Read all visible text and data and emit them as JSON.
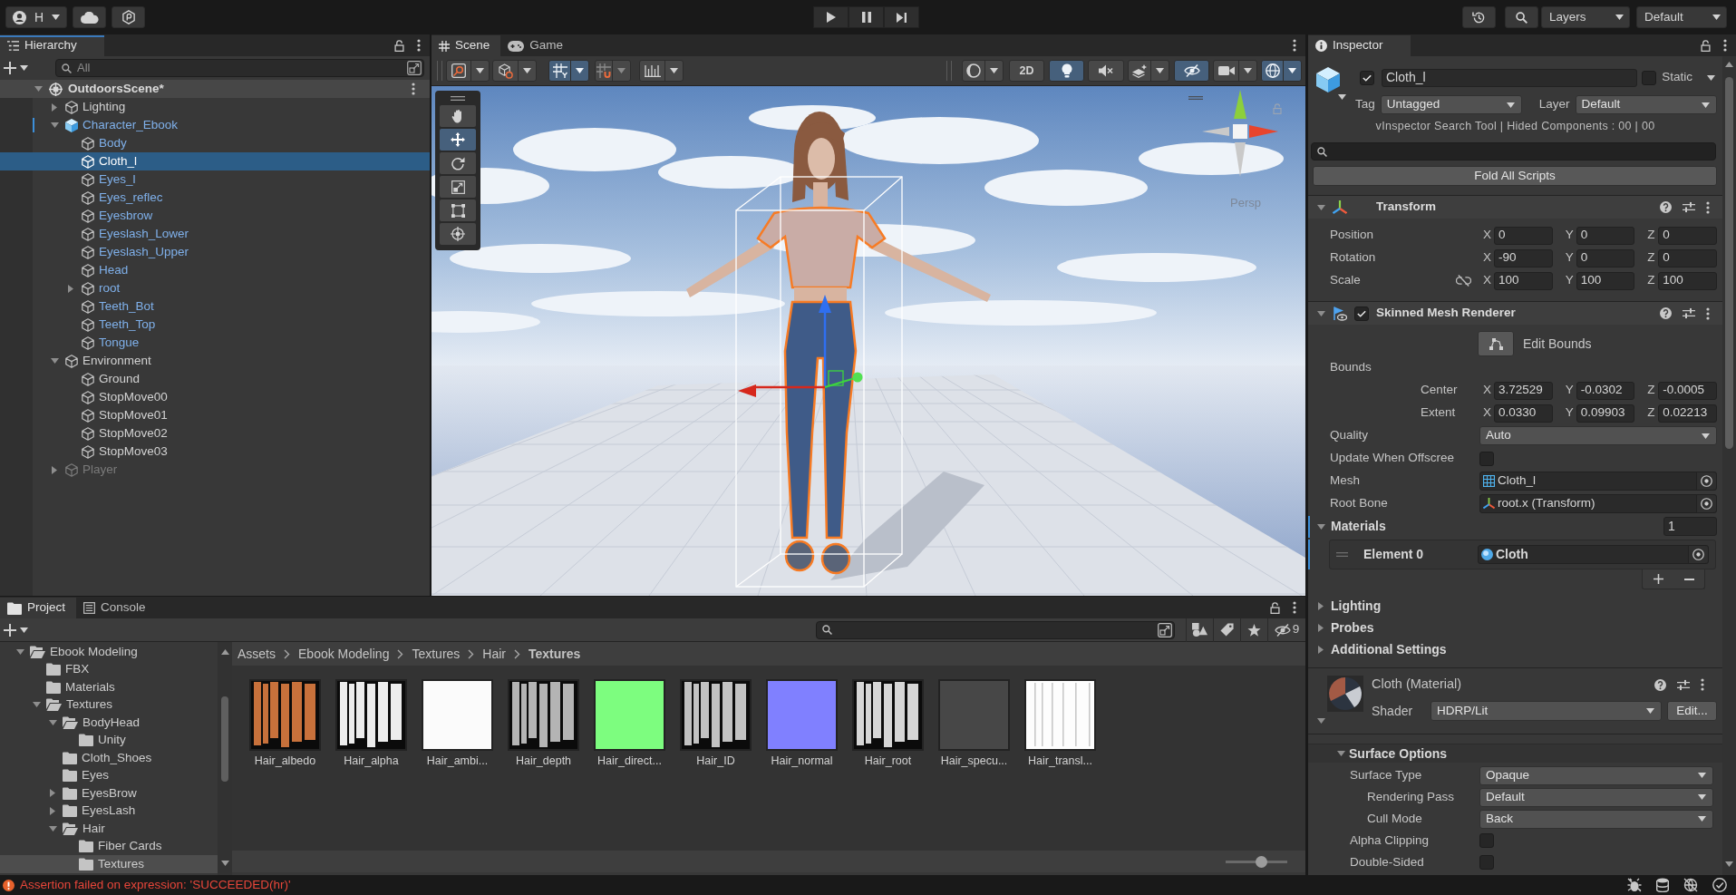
{
  "top_bar": {
    "account": "H",
    "layers": "Layers",
    "layout": "Default"
  },
  "hierarchy": {
    "tab": {
      "label": "Hierarchy",
      "selected": true,
      "focused": true
    },
    "search": {
      "placeholder": "All"
    },
    "scene": {
      "name": "OutdoorsScene*",
      "expanded": true
    },
    "items": [
      {
        "name": "Lighting",
        "kind": "object",
        "expanded": false,
        "overridden": false,
        "disabled": false,
        "selected": false
      },
      {
        "name": "Character_Ebook",
        "kind": "prefab_root",
        "expanded": true,
        "overridden": true,
        "disabled": false,
        "selected": false,
        "children": [
          {
            "name": "Body",
            "kind": "prefab_part",
            "disabled": false,
            "selected": false
          },
          {
            "name": "Cloth_l",
            "kind": "prefab_part",
            "disabled": false,
            "selected": true
          },
          {
            "name": "Eyes_l",
            "kind": "prefab_part",
            "disabled": false,
            "selected": false
          },
          {
            "name": "Eyes_reflec",
            "kind": "prefab_part",
            "disabled": false,
            "selected": false
          },
          {
            "name": "Eyesbrow",
            "kind": "prefab_part",
            "disabled": false,
            "selected": false
          },
          {
            "name": "Eyeslash_Lower",
            "kind": "prefab_part",
            "disabled": false,
            "selected": false
          },
          {
            "name": "Eyeslash_Upper",
            "kind": "prefab_part",
            "disabled": false,
            "selected": false
          },
          {
            "name": "Head",
            "kind": "prefab_part",
            "disabled": false,
            "selected": false
          },
          {
            "name": "root",
            "kind": "prefab_part",
            "expanded": false,
            "disabled": false,
            "selected": false
          },
          {
            "name": "Teeth_Bot",
            "kind": "prefab_part",
            "disabled": false,
            "selected": false
          },
          {
            "name": "Teeth_Top",
            "kind": "prefab_part",
            "disabled": false,
            "selected": false
          },
          {
            "name": "Tongue",
            "kind": "prefab_part",
            "disabled": false,
            "selected": false
          }
        ]
      },
      {
        "name": "Environment",
        "kind": "object",
        "expanded": true,
        "overridden": false,
        "disabled": false,
        "selected": false,
        "children": [
          {
            "name": "Ground",
            "kind": "object",
            "disabled": false,
            "selected": false
          },
          {
            "name": "StopMove00",
            "kind": "object",
            "disabled": false,
            "selected": false
          },
          {
            "name": "StopMove01",
            "kind": "object",
            "disabled": false,
            "selected": false
          },
          {
            "name": "StopMove02",
            "kind": "object",
            "disabled": false,
            "selected": false
          },
          {
            "name": "StopMove03",
            "kind": "object",
            "disabled": false,
            "selected": false
          }
        ]
      },
      {
        "name": "Player",
        "kind": "object",
        "expanded": false,
        "overridden": false,
        "disabled": true,
        "selected": false
      }
    ]
  },
  "scene_view": {
    "tabs": [
      {
        "label": "Scene",
        "kind": "scene",
        "selected": true
      },
      {
        "label": "Game",
        "kind": "game",
        "selected": false
      }
    ],
    "toolbar_left": [
      {
        "kind": "handle",
        "on": false
      },
      {
        "kind": "pivot",
        "on": false
      },
      {
        "kind": "grid",
        "on": true
      },
      {
        "kind": "snap",
        "on": false
      },
      {
        "kind": "increment",
        "on": false
      }
    ],
    "toolbar_right": [
      {
        "kind": "shading",
        "on": false
      },
      {
        "kind": "dimension",
        "label": "2D",
        "on": false
      },
      {
        "kind": "light",
        "on": true
      },
      {
        "kind": "audio",
        "on": false
      },
      {
        "kind": "effects",
        "on": false
      },
      {
        "kind": "visibility",
        "on": true
      },
      {
        "kind": "camera",
        "on": false
      },
      {
        "kind": "gizmos",
        "on": true
      }
    ],
    "tools": [
      {
        "kind": "hand",
        "selected": false
      },
      {
        "kind": "move",
        "selected": true
      },
      {
        "kind": "rotate",
        "selected": false
      },
      {
        "kind": "scale",
        "selected": false
      },
      {
        "kind": "rect",
        "selected": false
      },
      {
        "kind": "transform",
        "selected": false
      }
    ],
    "camera_mode": "Persp"
  },
  "inspector": {
    "tab": {
      "label": "Inspector",
      "selected": true,
      "focused": false
    },
    "object": {
      "active": true,
      "name": "Cloth_l",
      "static": false,
      "static_label": "Static",
      "tag_label": "Tag",
      "tag": "Untagged",
      "layer_label": "Layer",
      "layer": "Default"
    },
    "plugin_info": "vInspector Search Tool | Hided Components : 00 | 00",
    "fold_button": "Fold All Scripts",
    "transform": {
      "title": "Transform",
      "expanded": true,
      "rows": [
        {
          "label": "Position",
          "values": [
            {
              "axis": "X",
              "value": "0"
            },
            {
              "axis": "Y",
              "value": "0"
            },
            {
              "axis": "Z",
              "value": "0"
            }
          ]
        },
        {
          "label": "Rotation",
          "values": [
            {
              "axis": "X",
              "value": "-90"
            },
            {
              "axis": "Y",
              "value": "0"
            },
            {
              "axis": "Z",
              "value": "0"
            }
          ]
        },
        {
          "label": "Scale",
          "linked": false,
          "values": [
            {
              "axis": "X",
              "value": "100"
            },
            {
              "axis": "Y",
              "value": "100"
            },
            {
              "axis": "Z",
              "value": "100"
            }
          ]
        }
      ]
    },
    "renderer": {
      "title": "Skinned Mesh Renderer",
      "enabled": true,
      "expanded": true,
      "edit_bounds": "Edit Bounds",
      "bounds": {
        "label": "Bounds",
        "rows": [
          {
            "label": "Center",
            "values": [
              {
                "axis": "X",
                "value": "3.72529"
              },
              {
                "axis": "Y",
                "value": "-0.0302"
              },
              {
                "axis": "Z",
                "value": "-0.0005"
              }
            ]
          },
          {
            "label": "Extent",
            "values": [
              {
                "axis": "X",
                "value": "0.0330"
              },
              {
                "axis": "Y",
                "value": "0.09903"
              },
              {
                "axis": "Z",
                "value": "0.02213"
              }
            ]
          }
        ]
      },
      "properties": [
        {
          "kind": "dropdown",
          "label": "Quality",
          "value": "Auto"
        },
        {
          "kind": "checkbox",
          "label": "Update When Offscree",
          "checked": false
        },
        {
          "kind": "mesh",
          "label": "Mesh",
          "value": "Cloth_l"
        },
        {
          "kind": "transform",
          "label": "Root Bone",
          "value": "root.x (Transform)"
        }
      ],
      "materials": {
        "label": "Materials",
        "expanded": true,
        "overridden": true,
        "count": "1",
        "elements": [
          {
            "label": "Element 0",
            "value": "Cloth",
            "overridden": true
          }
        ]
      },
      "foldouts": [
        {
          "label": "Lighting",
          "expanded": false
        },
        {
          "label": "Probes",
          "expanded": false
        },
        {
          "label": "Additional Settings",
          "expanded": false
        }
      ]
    },
    "material": {
      "title": "Cloth (Material)",
      "expanded": true,
      "shader_label": "Shader",
      "shader": "HDRP/Lit",
      "edit_button": "Edit...",
      "section": {
        "title": "Surface Options",
        "expanded": true,
        "rows": [
          {
            "kind": "dropdown",
            "label": "Surface Type",
            "value": "Opaque",
            "children": [
              {
                "kind": "dropdown",
                "label": "Rendering Pass",
                "value": "Default"
              },
              {
                "kind": "dropdown",
                "label": "Cull Mode",
                "value": "Back"
              }
            ]
          },
          {
            "kind": "checkbox",
            "label": "Alpha Clipping",
            "checked": false
          },
          {
            "kind": "checkbox",
            "label": "Double-Sided",
            "checked": false
          }
        ]
      }
    }
  },
  "project": {
    "tabs": [
      {
        "label": "Project",
        "kind": "project",
        "selected": true
      },
      {
        "label": "Console",
        "kind": "console",
        "selected": false
      }
    ],
    "hidden_count": "9",
    "tree": [
      {
        "name": "Ebook Modeling",
        "expanded": true,
        "selected": false,
        "children": [
          {
            "name": "FBX",
            "selected": false
          },
          {
            "name": "Materials",
            "selected": false
          },
          {
            "name": "Textures",
            "expanded": true,
            "selected": false,
            "children": [
              {
                "name": "BodyHead",
                "expanded": true,
                "selected": false,
                "children": [
                  {
                    "name": "Unity",
                    "selected": false
                  }
                ]
              },
              {
                "name": "Cloth_Shoes",
                "selected": false
              },
              {
                "name": "Eyes",
                "selected": false
              },
              {
                "name": "EyesBrow",
                "expanded": false,
                "selected": false
              },
              {
                "name": "EyesLash",
                "expanded": false,
                "selected": false
              },
              {
                "name": "Hair",
                "expanded": true,
                "selected": false,
                "children": [
                  {
                    "name": "Fiber Cards",
                    "selected": false
                  },
                  {
                    "name": "Textures",
                    "selected": true
                  }
                ]
              }
            ]
          }
        ]
      }
    ],
    "breadcrumb": [
      "Assets",
      "Ebook Modeling",
      "Textures",
      "Hair",
      "Textures"
    ],
    "assets": [
      {
        "name": "Hair_albedo",
        "kind": "strands",
        "color": "#c8713b",
        "selected": false
      },
      {
        "name": "Hair_alpha",
        "kind": "strands",
        "color": "#ededed",
        "selected": false
      },
      {
        "name": "Hair_ambi...",
        "kind": "flat",
        "color": "#fbfbfb",
        "selected": false
      },
      {
        "name": "Hair_depth",
        "kind": "strands",
        "color": "#b4b4b4",
        "selected": false
      },
      {
        "name": "Hair_direct...",
        "kind": "flat",
        "color": "#7dfd7f",
        "selected": false
      },
      {
        "name": "Hair_ID",
        "kind": "strands",
        "color": "#c2c2c2",
        "selected": false
      },
      {
        "name": "Hair_normal",
        "kind": "flat",
        "color": "#8080ff",
        "selected": false
      },
      {
        "name": "Hair_root",
        "kind": "strands",
        "color": "#d6d6d6",
        "selected": false
      },
      {
        "name": "Hair_specu...",
        "kind": "flat",
        "color": "#474747",
        "selected": false
      },
      {
        "name": "Hair_transl...",
        "kind": "faint",
        "color": "#c9c9c9",
        "selected": false
      }
    ],
    "icon_size": {
      "level": 0.58
    }
  },
  "status": {
    "error": true,
    "message": "Assertion failed on expression: 'SUCCEEDED(hr)'"
  }
}
